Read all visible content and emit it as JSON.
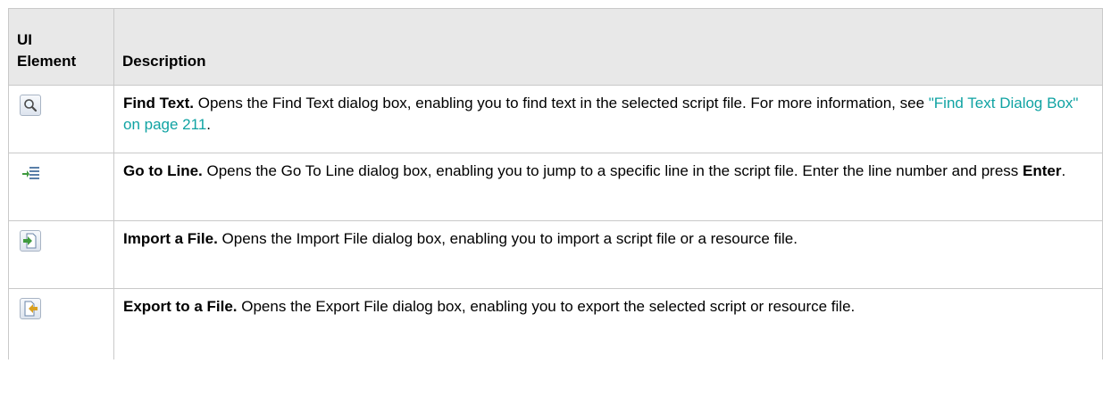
{
  "header": {
    "col1": "UI Element",
    "col1_line1": "UI",
    "col1_line2": "Element",
    "col2": "Description"
  },
  "rows": [
    {
      "icon": "search-icon",
      "term": "Find Text.",
      "text": " Opens the Find Text dialog box, enabling you to find text in the selected script file. For more information, see ",
      "link": "\"Find Text Dialog Box\" on page 211",
      "tail": "."
    },
    {
      "icon": "go-to-line-icon",
      "term": "Go to Line.",
      "text": " Opens the Go To Line dialog box, enabling you to jump to a specific line in the script file. Enter the line number and press ",
      "strong": "Enter",
      "tail": "."
    },
    {
      "icon": "import-file-icon",
      "term": "Import a File.",
      "text": " Opens the Import File dialog box, enabling you to import a script file or a resource file."
    },
    {
      "icon": "export-file-icon",
      "term": "Export to a File.",
      "text": " Opens the Export File dialog box, enabling you to export the selected script or resource file."
    }
  ],
  "colors": {
    "header_bg": "#e8e8e8",
    "border": "#c9c9c9",
    "link": "#10a3a3"
  }
}
